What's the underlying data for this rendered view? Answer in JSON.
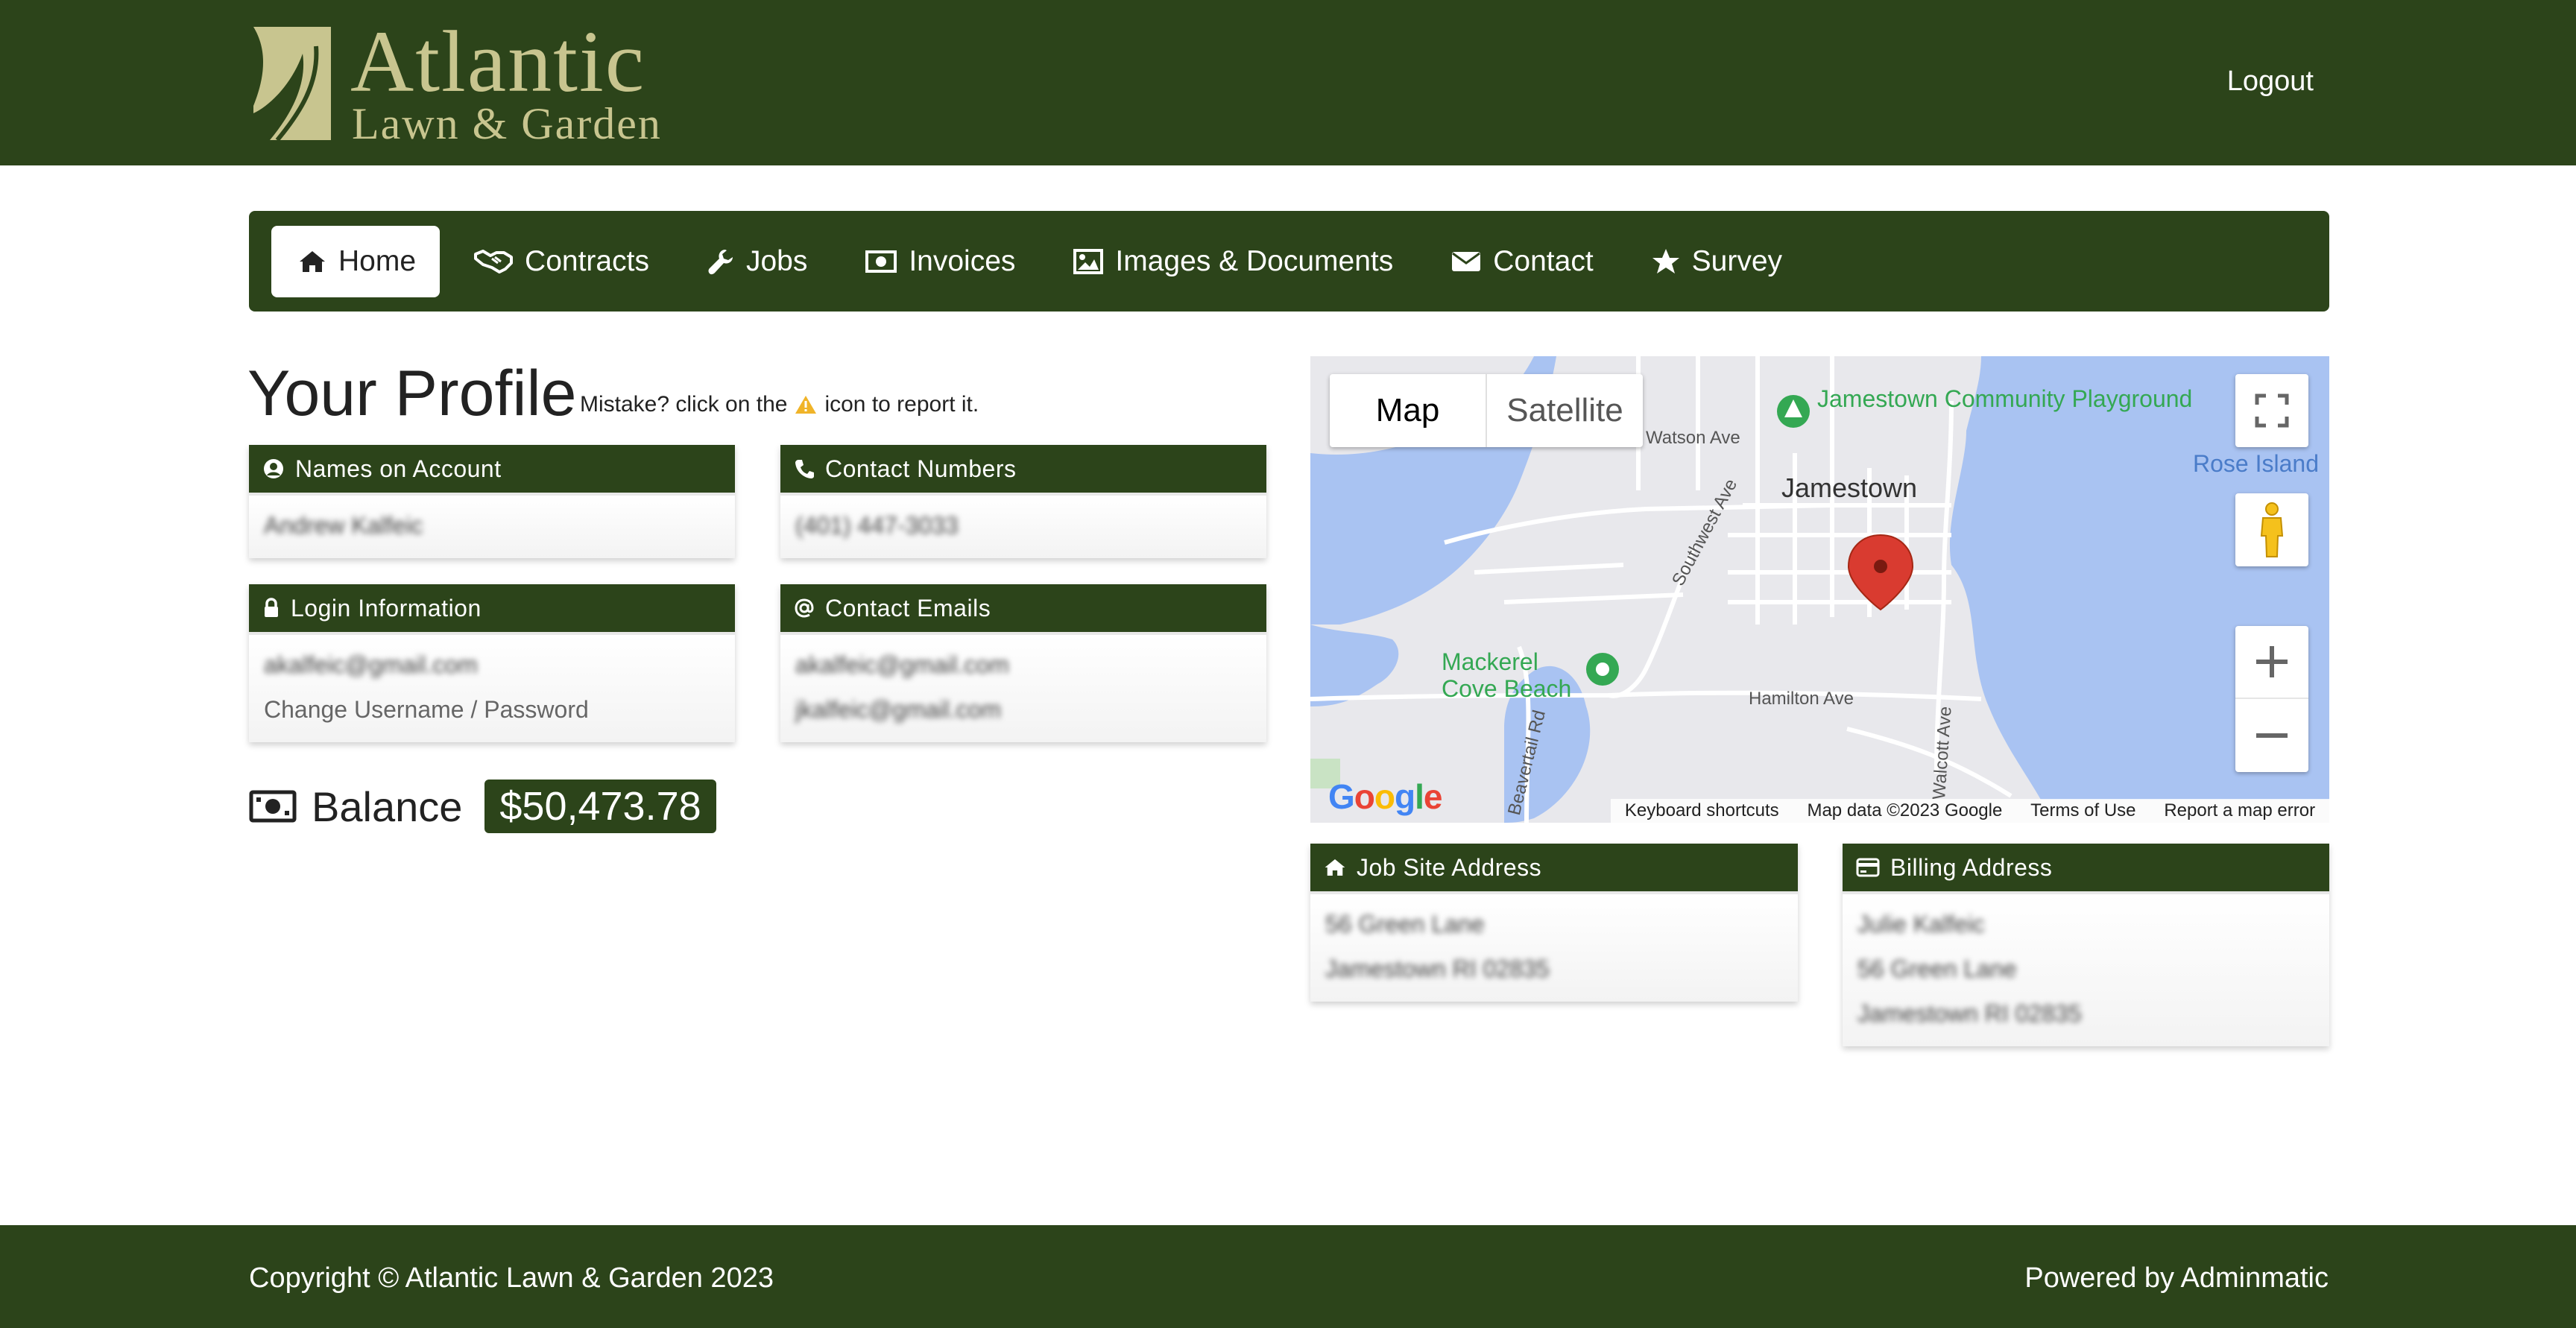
{
  "header": {
    "logo_title": "Atlantic",
    "logo_subtitle": "Lawn & Garden",
    "logout_label": "Logout"
  },
  "nav": {
    "items": [
      {
        "label": "Home",
        "icon": "home-icon"
      },
      {
        "label": "Contracts",
        "icon": "handshake-icon"
      },
      {
        "label": "Jobs",
        "icon": "wrench-icon"
      },
      {
        "label": "Invoices",
        "icon": "money-icon"
      },
      {
        "label": "Images & Documents",
        "icon": "image-icon"
      },
      {
        "label": "Contact",
        "icon": "envelope-icon"
      },
      {
        "label": "Survey",
        "icon": "star-icon"
      }
    ]
  },
  "profile": {
    "title": "Your Profile",
    "mistake_prefix": "Mistake? click on the",
    "mistake_suffix": "icon to report it."
  },
  "cards": {
    "names": {
      "title": "Names on Account",
      "lines": [
        "Andrew Kalfeic"
      ]
    },
    "numbers": {
      "title": "Contact Numbers",
      "lines": [
        "(401) 447-3033"
      ]
    },
    "login": {
      "title": "Login Information",
      "lines": [
        "akalfeic@gmail.com"
      ],
      "link": "Change Username / Password"
    },
    "emails": {
      "title": "Contact Emails",
      "lines": [
        "akalfeic@gmail.com",
        "jkalfeic@gmail.com"
      ]
    },
    "jobsite": {
      "title": "Job Site Address",
      "lines": [
        "56 Green Lane",
        "Jamestown RI 02835"
      ]
    },
    "billing": {
      "title": "Billing Address",
      "lines": [
        "Julie Kalfeic",
        "56 Green Lane",
        "Jamestown RI 02835"
      ]
    }
  },
  "balance": {
    "label": "Balance",
    "amount": "$50,473.78"
  },
  "map": {
    "type_map": "Map",
    "type_satellite": "Satellite",
    "labels": {
      "playground": "Jamestown Community Playground",
      "watson": "Watson Ave",
      "jamestown": "Jamestown",
      "rose": "Rose Island",
      "southwest": "Southwest Ave",
      "mackerel": "Mackerel Cove Beach",
      "hamilton": "Hamilton Ave",
      "beavertail": "Beavertail Rd",
      "walcott": "Walcott Ave"
    },
    "footer": {
      "shortcuts": "Keyboard shortcuts",
      "mapdata": "Map data ©2023 Google",
      "terms": "Terms of Use",
      "report": "Report a map error"
    },
    "google": "Google"
  },
  "footer": {
    "copyright": "Copyright © Atlantic Lawn & Garden 2023",
    "powered": "Powered by Adminmatic"
  },
  "colors": {
    "brand_green": "#2c441a",
    "logo_gold": "#c8c58f",
    "warning_yellow": "#f0b429",
    "water": "#a9c3f2",
    "pin_red": "#d93b30"
  }
}
